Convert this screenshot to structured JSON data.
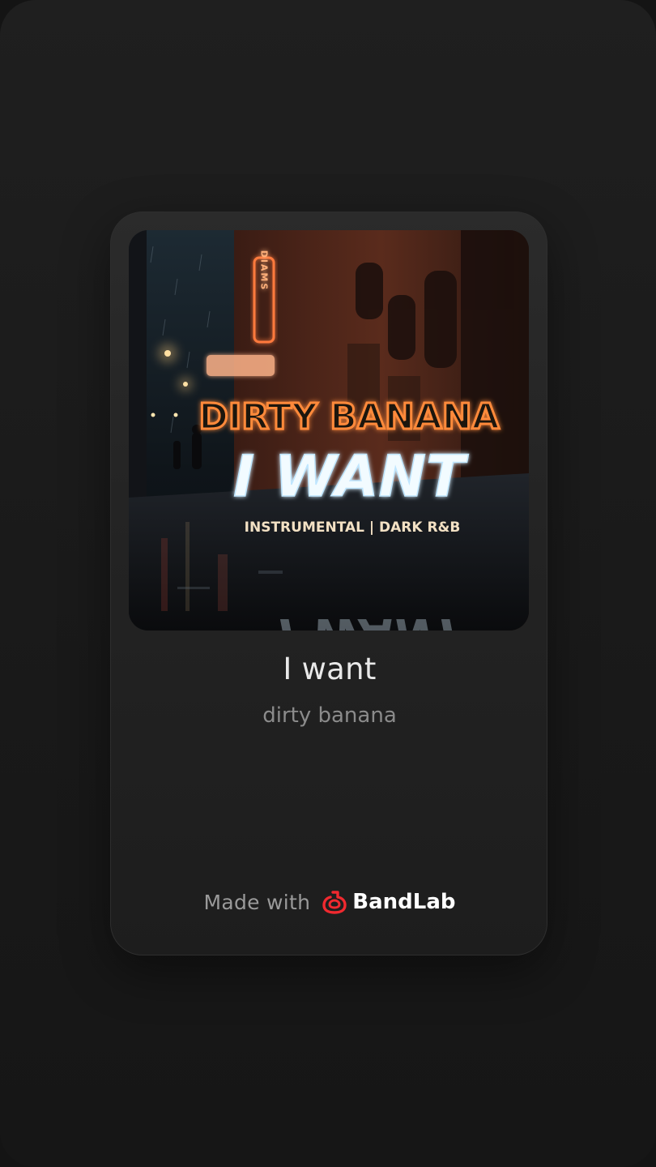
{
  "track": {
    "title": "I want",
    "artist": "dirty banana"
  },
  "cover": {
    "artist_text": "DIRTY BANANA",
    "title_text": "I WANT",
    "subtitle_text": "INSTRUMENTAL | DARK R&B",
    "neon_sign_text": "DIAMS"
  },
  "footer": {
    "made_with_label": "Made with",
    "brand_name": "BandLab",
    "brand_icon": "bandlab-logo-icon",
    "brand_color": "#f0292f"
  }
}
